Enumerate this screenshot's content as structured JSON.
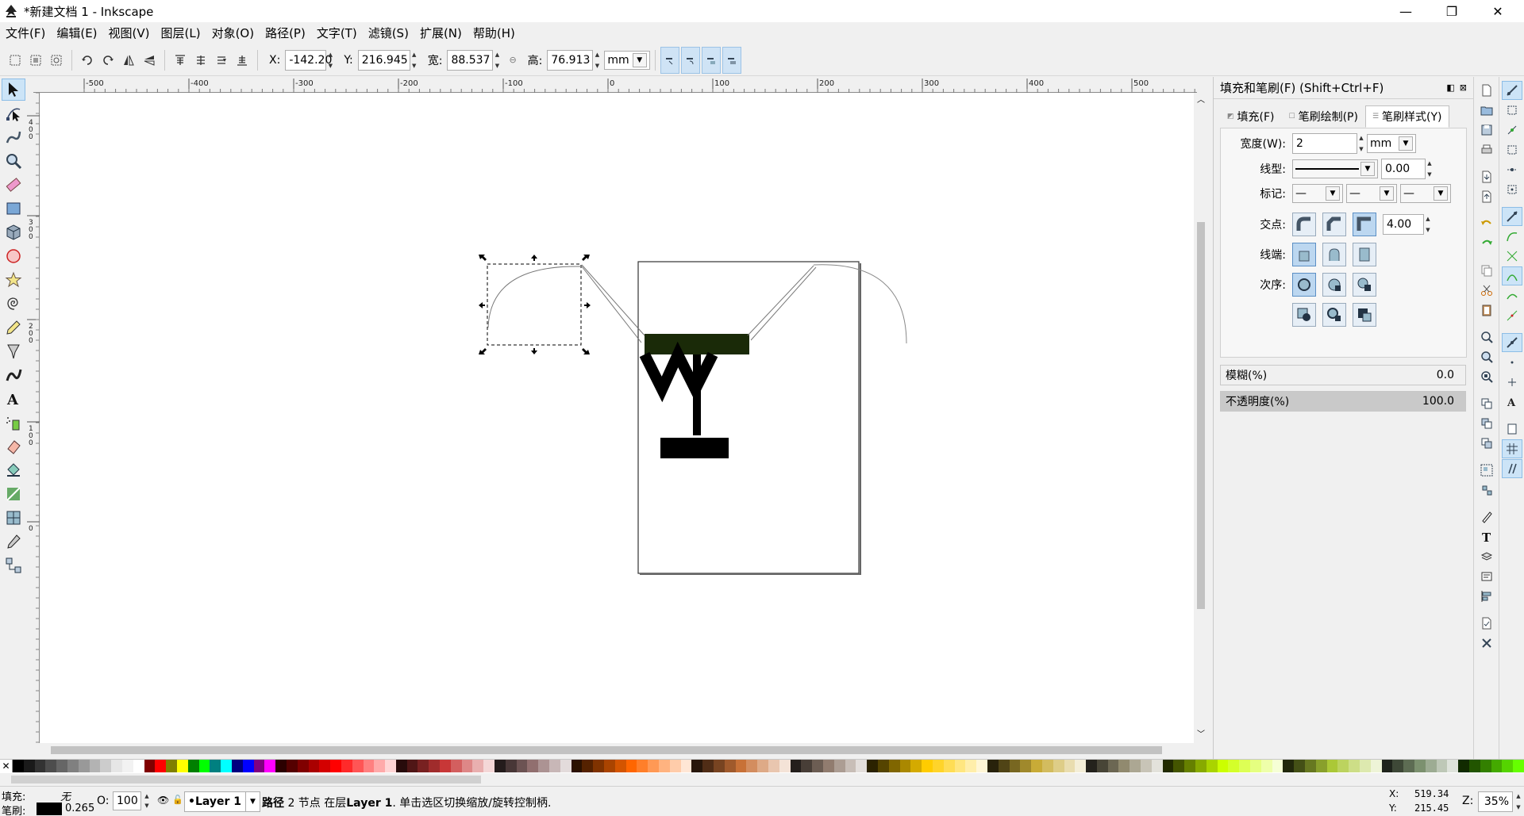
{
  "window": {
    "title": "*新建文档 1 - Inkscape",
    "minimize": "—",
    "maximize": "❐",
    "close": "✕"
  },
  "menu": [
    {
      "label": "文件(F)"
    },
    {
      "label": "编辑(E)"
    },
    {
      "label": "视图(V)"
    },
    {
      "label": "图层(L)"
    },
    {
      "label": "对象(O)"
    },
    {
      "label": "路径(P)"
    },
    {
      "label": "文字(T)"
    },
    {
      "label": "滤镜(S)"
    },
    {
      "label": "扩展(N)"
    },
    {
      "label": "帮助(H)"
    }
  ],
  "controls": {
    "x_label": "X:",
    "x_value": "-142.20",
    "y_label": "Y:",
    "y_value": "216.945",
    "w_label": "宽:",
    "w_value": "88.537",
    "h_label": "高:",
    "h_value": "76.913",
    "unit": "mm"
  },
  "ruler": {
    "h_ticks": [
      "-500",
      "-400",
      "-300",
      "-200",
      "-100",
      "0",
      "100",
      "200",
      "300",
      "400",
      "500"
    ],
    "v_ticks": [
      "400",
      "300",
      "200",
      "100",
      "0"
    ]
  },
  "dock": {
    "title": "填充和笔刷(F) (Shift+Ctrl+F)",
    "tabs": [
      {
        "label": "填充(F)",
        "active": false
      },
      {
        "label": "笔刷绘制(P)",
        "active": false
      },
      {
        "label": "笔刷样式(Y)",
        "active": true
      }
    ],
    "width_label": "宽度(W):",
    "width_value": "2",
    "width_unit": "mm",
    "dash_label": "线型:",
    "dash_offset": "0.00",
    "markers_label": "标记:",
    "join_label": "交点:",
    "miter_value": "4.00",
    "cap_label": "线端:",
    "order_label": "次序:",
    "blur_label": "模糊(%)",
    "blur_value": "0.0",
    "opacity_label": "不透明度(%)",
    "opacity_value": "100.0"
  },
  "status": {
    "fill_label": "填充:",
    "fill_value": "无",
    "stroke_label": "笔刷:",
    "stroke_width": "0.265",
    "opacity_label": "O:",
    "opacity_value": "100",
    "layer": "•Layer 1",
    "message_bold": "路径",
    "message_mid": " 2 节点 在层",
    "message_layer": "Layer 1",
    "message_end": ". 单击选区切换缩放/旋转控制柄.",
    "cursor_x_label": "X:",
    "cursor_x": "519.34",
    "cursor_y_label": "Y:",
    "cursor_y": "215.45",
    "zoom_label": "Z:",
    "zoom_value": "35%"
  },
  "palette_colors": [
    "#000000",
    "#1a1a1a",
    "#333333",
    "#4d4d4d",
    "#666666",
    "#808080",
    "#999999",
    "#b3b3b3",
    "#cccccc",
    "#e6e6e6",
    "#f2f2f2",
    "#ffffff",
    "#800000",
    "#ff0000",
    "#808000",
    "#ffff00",
    "#008000",
    "#00ff00",
    "#008080",
    "#00ffff",
    "#000080",
    "#0000ff",
    "#800080",
    "#ff00ff",
    "#2b0000",
    "#550000",
    "#800000",
    "#aa0000",
    "#d40000",
    "#ff0000",
    "#ff2a2a",
    "#ff5555",
    "#ff8080",
    "#ffaaaa",
    "#ffd5d5",
    "#280b0b",
    "#501616",
    "#782121",
    "#a02c2c",
    "#c83737",
    "#d35f5f",
    "#de8787",
    "#e9afaf",
    "#f4d7d7",
    "#241c1c",
    "#483737",
    "#6c5353",
    "#916f6f",
    "#ac9393",
    "#c8b7b7",
    "#e3dbdb",
    "#2b1100",
    "#552200",
    "#803300",
    "#aa4400",
    "#d45500",
    "#ff6600",
    "#ff7f2a",
    "#ff9955",
    "#ffb380",
    "#ffccaa",
    "#ffe6d5",
    "#28170b",
    "#502d16",
    "#784421",
    "#a05a2c",
    "#c87137",
    "#d38d5f",
    "#deaa87",
    "#e9c6af",
    "#f4e3d7",
    "#241f1c",
    "#483e37",
    "#6c5d53",
    "#917c6f",
    "#ac9d93",
    "#c8beb7",
    "#e3dedb",
    "#2b2200",
    "#554400",
    "#806600",
    "#aa8800",
    "#d4aa00",
    "#ffcc00",
    "#ffd42a",
    "#ffdd55",
    "#ffe680",
    "#ffeeaa",
    "#fff6d5",
    "#28220b",
    "#504416",
    "#786721",
    "#a0892c",
    "#c8ab37",
    "#d3bc5f",
    "#decd87",
    "#e9ddaf",
    "#f4eed7",
    "#24221c",
    "#484537",
    "#6c6753",
    "#918a6f",
    "#aca793",
    "#c8c4b7",
    "#e3e2db",
    "#222b00",
    "#445500",
    "#668000",
    "#88aa00",
    "#aad400",
    "#ccff00",
    "#d4ff2a",
    "#ddff55",
    "#e5ff80",
    "#eeffaa",
    "#f6ffd5",
    "#22280b",
    "#445016",
    "#677821",
    "#89a02c",
    "#abc837",
    "#bcd35f",
    "#cdde87",
    "#dde9af",
    "#eef4d7",
    "#1f241c",
    "#3e4837",
    "#5d6c53",
    "#7c916f",
    "#9dac93",
    "#bec8b7",
    "#dee3db",
    "#112b00",
    "#225500",
    "#338000",
    "#44aa00",
    "#55d400",
    "#66ff00"
  ]
}
